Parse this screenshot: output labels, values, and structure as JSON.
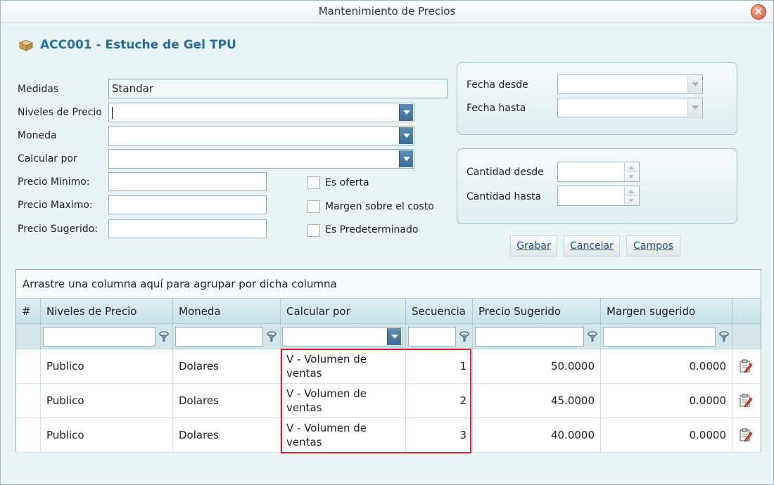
{
  "window": {
    "title": "Mantenimiento de Precios",
    "close_symbol": "×"
  },
  "product": {
    "title": "ACC001 - Estuche de Gel TPU",
    "icon": "box-icon"
  },
  "form": {
    "medidas_label": "Medidas",
    "medidas_value": "Standar",
    "niveles_label": "Niveles de Precio",
    "niveles_value": "",
    "moneda_label": "Moneda",
    "moneda_value": "",
    "calcular_label": "Calcular por",
    "calcular_value": "",
    "precio_minimo_label": "Precio Minimo:",
    "precio_minimo_value": "",
    "precio_maximo_label": "Precio Maximo:",
    "precio_maximo_value": "",
    "precio_sugerido_label": "Precio Sugerido:",
    "precio_sugerido_value": "",
    "es_oferta_label": "Es oferta",
    "es_oferta_checked": false,
    "margen_costo_label": "Margen sobre el costo",
    "margen_costo_checked": false,
    "es_predeterminado_label": "Es Predeterminado",
    "es_predeterminado_checked": false
  },
  "dates": {
    "fecha_desde_label": "Fecha desde",
    "fecha_desde_value": "",
    "fecha_hasta_label": "Fecha hasta",
    "fecha_hasta_value": ""
  },
  "quantities": {
    "cantidad_desde_label": "Cantidad desde",
    "cantidad_desde_value": "",
    "cantidad_hasta_label": "Cantidad hasta",
    "cantidad_hasta_value": ""
  },
  "actions": {
    "grabar": "Grabar",
    "cancelar": "Cancelar",
    "campos": "Campos"
  },
  "grid": {
    "group_hint": "Arrastre una columna aquí para agrupar por dicha columna",
    "columns": [
      "#",
      "Niveles de Precio",
      "Moneda",
      "Calcular por",
      "Secuencia",
      "Precio Sugerido",
      "Margen sugerido"
    ],
    "rows": [
      {
        "nivel": "Publico",
        "moneda": "Dolares",
        "calcular": "V - Volumen de ventas",
        "secuencia": "1",
        "precio": "50.0000",
        "margen": "0.0000"
      },
      {
        "nivel": "Publico",
        "moneda": "Dolares",
        "calcular": "V - Volumen de ventas",
        "secuencia": "2",
        "precio": "45.0000",
        "margen": "0.0000"
      },
      {
        "nivel": "Publico",
        "moneda": "Dolares",
        "calcular": "V - Volumen de ventas",
        "secuencia": "3",
        "precio": "40.0000",
        "margen": "0.0000"
      }
    ]
  },
  "colors": {
    "title_blue": "#2a6d9c",
    "highlight_red": "#d9242f",
    "link_blue": "#1d4f8c"
  }
}
